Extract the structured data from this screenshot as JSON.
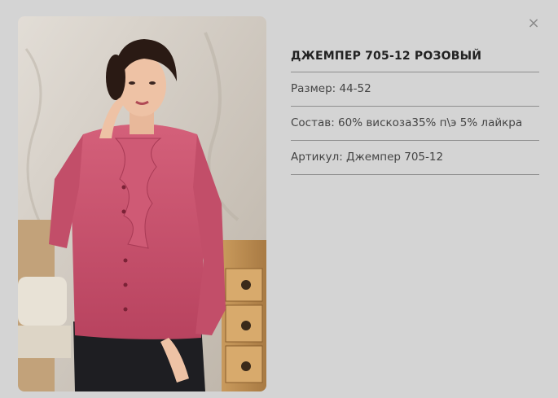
{
  "modal": {
    "close_symbol": "×",
    "close_icon": "close-icon"
  },
  "product": {
    "image_alt": "product-photo",
    "title": "ДЖЕМПЕР 705-12 РОЗОВЫЙ",
    "size": "Размер: 44-52",
    "composition": "Состав: 60% вискоза35% п\\э 5% лайкра",
    "article": "Артикул: Джемпер 705-12"
  },
  "colors": {
    "blouse": "#c9506a",
    "background": "#d4d4d4",
    "divider": "#8e8e8e"
  }
}
